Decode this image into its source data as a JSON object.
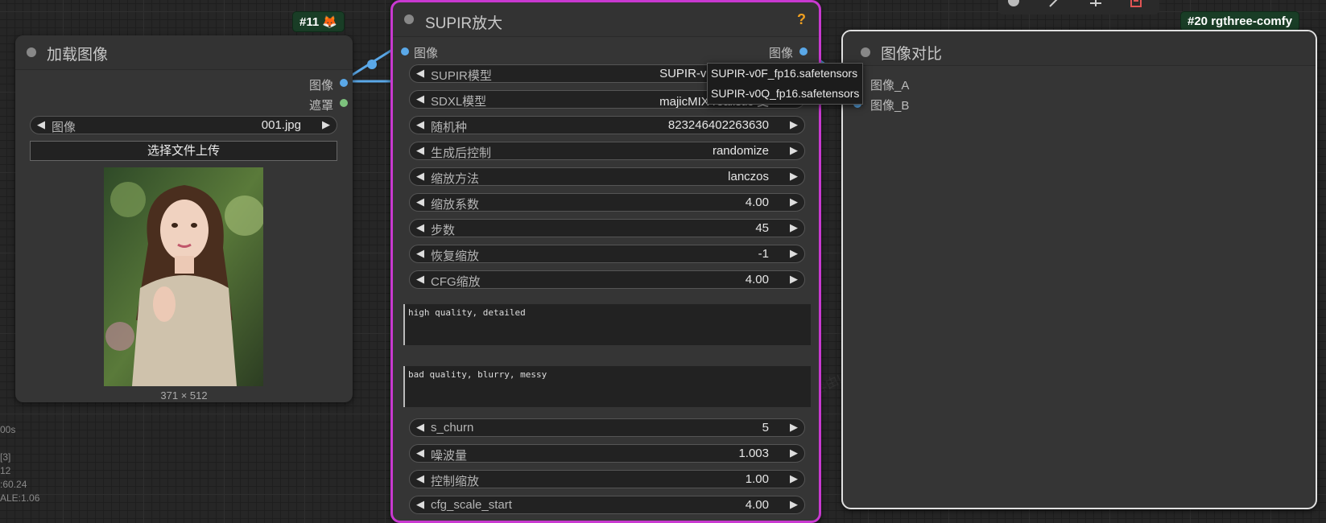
{
  "load_node": {
    "badge": "#11 🦊",
    "title": "加载图像",
    "outputs": [
      "图像",
      "遮罩"
    ],
    "image_widget_label": "图像",
    "image_widget_value": "001.jpg",
    "upload_button": "选择文件上传",
    "image_size": "371 × 512"
  },
  "supir_node": {
    "title": "SUPIR放大",
    "help_icon": "?",
    "input_label": "图像",
    "output_label": "图像",
    "widgets": [
      {
        "label": "SUPIR模型",
        "value": "SUPIR-v0Q_fp16.sa"
      },
      {
        "label": "SDXL模型",
        "value": "majicMIX realistic 麦"
      },
      {
        "label": "随机种",
        "value": "823246402263630"
      },
      {
        "label": "生成后控制",
        "value": "randomize"
      },
      {
        "label": "缩放方法",
        "value": "lanczos"
      },
      {
        "label": "缩放系数",
        "value": "4.00"
      },
      {
        "label": "步数",
        "value": "45"
      },
      {
        "label": "恢复缩放",
        "value": "-1"
      },
      {
        "label": "CFG缩放",
        "value": "4.00"
      }
    ],
    "positive_prompt": "high quality, detailed",
    "negative_prompt": "bad quality, blurry, messy",
    "widgets2": [
      {
        "label": "s_churn",
        "value": "5"
      },
      {
        "label": "噪波量",
        "value": "1.003"
      },
      {
        "label": "控制缩放",
        "value": "1.00"
      },
      {
        "label": "cfg_scale_start",
        "value": "4.00"
      }
    ]
  },
  "dropdown": {
    "options": [
      "SUPIR-v0F_fp16.safetensors",
      "SUPIR-v0Q_fp16.safetensors"
    ]
  },
  "compare_node": {
    "badge": "#20 rgthree-comfy",
    "title": "图像对比",
    "inputs": [
      "图像_A",
      "图像_B"
    ]
  },
  "stats": {
    "lines": [
      "00s",
      "[3]",
      "12",
      ":60.24",
      "ALE:1.06"
    ]
  },
  "watermark_text": "内容由Liblib AI生成",
  "colors": {
    "image_slot": "#5aa8e8",
    "mask_slot": "#7dc27d",
    "supir_border": "#c839d0",
    "link": "#5aa8e8"
  }
}
